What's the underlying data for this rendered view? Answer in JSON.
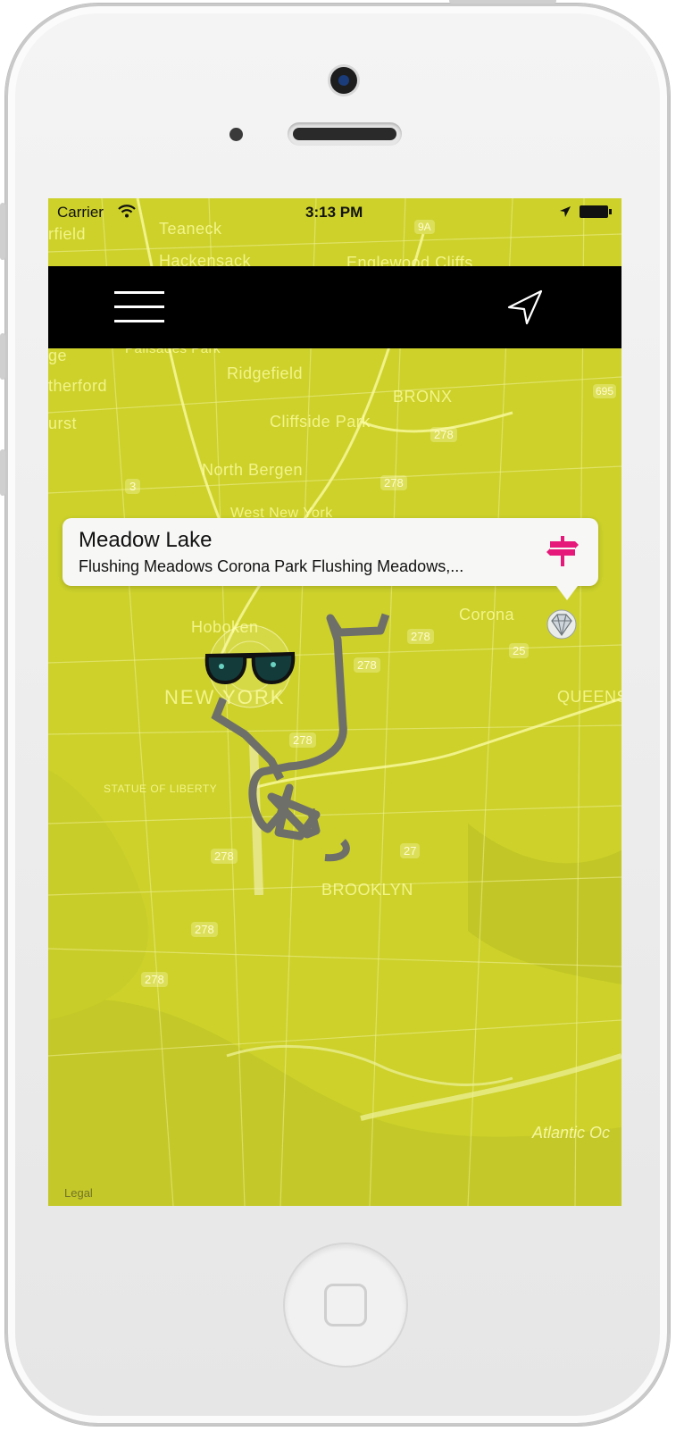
{
  "status_bar": {
    "carrier": "Carrier",
    "time": "3:13 PM"
  },
  "callout": {
    "title": "Meadow Lake",
    "subtitle": "Flushing Meadows Corona Park Flushing Meadows,...",
    "icon": "signpost-icon"
  },
  "map": {
    "labels": [
      "Teaneck",
      "Hackensack",
      "Englewood Cliffs",
      "Ridgefield",
      "BRONX",
      "Cliffside Park",
      "North Bergen",
      "West New York",
      "Hoboken",
      "NEW YORK",
      "STATUE OF LIBERTY",
      "Corona",
      "QUEENS",
      "BROOKLYN",
      "Atlantic Oc",
      "rfield",
      "therford",
      "urst",
      "ge",
      "Palisades Park"
    ],
    "highway_shields": [
      "9A",
      "278",
      "278",
      "3",
      "278",
      "278",
      "25",
      "278",
      "27",
      "278",
      "278",
      "278",
      "695"
    ],
    "legal": "Legal"
  },
  "colors": {
    "map_tint": "#cdd12a",
    "nav_bg": "#000000",
    "accent": "#e6197a"
  }
}
